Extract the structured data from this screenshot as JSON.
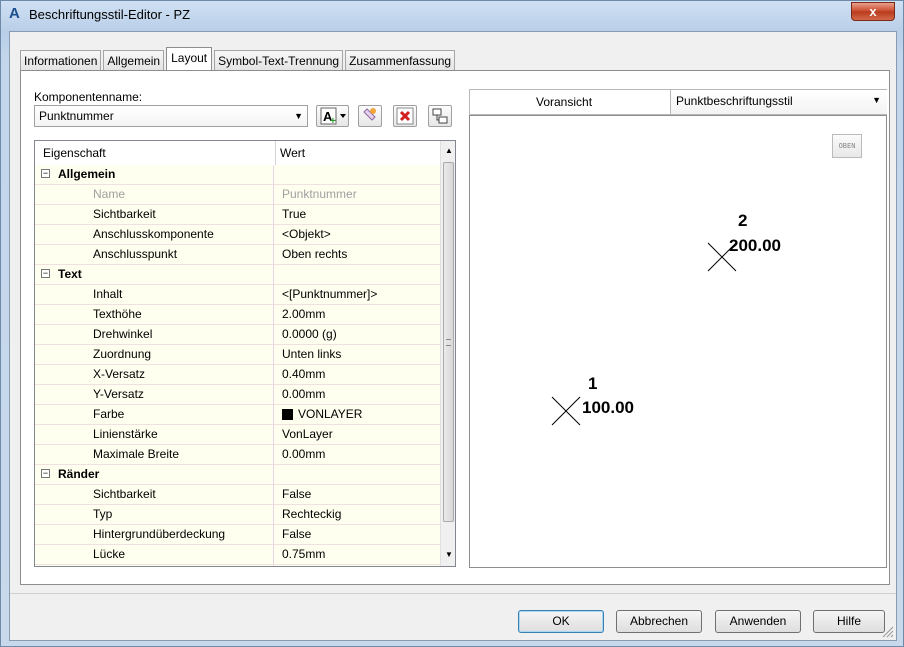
{
  "window": {
    "title": "Beschriftungsstil-Editor - PZ",
    "close_label": "x"
  },
  "tabs": [
    {
      "label": "Informationen",
      "active": false
    },
    {
      "label": "Allgemein",
      "active": false
    },
    {
      "label": "Layout",
      "active": true
    },
    {
      "label": "Symbol-Text-Trennung",
      "active": false
    },
    {
      "label": "Zusammenfassung",
      "active": false
    }
  ],
  "component": {
    "label": "Komponentenname:",
    "value": "Punktnummer"
  },
  "grid": {
    "headers": {
      "property": "Eigenschaft",
      "value": "Wert"
    },
    "rows": [
      {
        "name": "Allgemein",
        "value": "",
        "type": "category"
      },
      {
        "name": "Name",
        "value": "Punktnummer",
        "type": "disabled"
      },
      {
        "name": "Sichtbarkeit",
        "value": "True"
      },
      {
        "name": "Anschlusskomponente",
        "value": "<Objekt>"
      },
      {
        "name": "Anschlusspunkt",
        "value": "Oben rechts"
      },
      {
        "name": "Text",
        "value": "",
        "type": "category"
      },
      {
        "name": "Inhalt",
        "value": "<[Punktnummer]>"
      },
      {
        "name": "Texthöhe",
        "value": "2.00mm"
      },
      {
        "name": "Drehwinkel",
        "value": "0.0000 (g)"
      },
      {
        "name": "Zuordnung",
        "value": "Unten links"
      },
      {
        "name": "X-Versatz",
        "value": "0.40mm"
      },
      {
        "name": "Y-Versatz",
        "value": "0.00mm"
      },
      {
        "name": "Farbe",
        "value": "VONLAYER",
        "type": "color"
      },
      {
        "name": "Linienstärke",
        "value": "VonLayer"
      },
      {
        "name": "Maximale Breite",
        "value": "0.00mm"
      },
      {
        "name": "Ränder",
        "value": "",
        "type": "category"
      },
      {
        "name": "Sichtbarkeit",
        "value": "False"
      },
      {
        "name": "Typ",
        "value": "Rechteckig"
      },
      {
        "name": "Hintergrundüberdeckung",
        "value": "False"
      },
      {
        "name": "Lücke",
        "value": "0.75mm"
      },
      {
        "name": "",
        "value": "",
        "type": "partial"
      }
    ]
  },
  "preview": {
    "label": "Voransicht",
    "style_select": "Punktbeschriftungsstil",
    "view_badge": "OBEN",
    "points": [
      {
        "number": "1",
        "elevation": "100.00"
      },
      {
        "number": "2",
        "elevation": "200.00"
      }
    ]
  },
  "buttons": {
    "ok": "OK",
    "cancel": "Abbrechen",
    "apply": "Anwenden",
    "help": "Hilfe"
  },
  "colors": {
    "accent": "#3c7fb1",
    "close": "#c84628",
    "row_bg": "#fffff0"
  }
}
